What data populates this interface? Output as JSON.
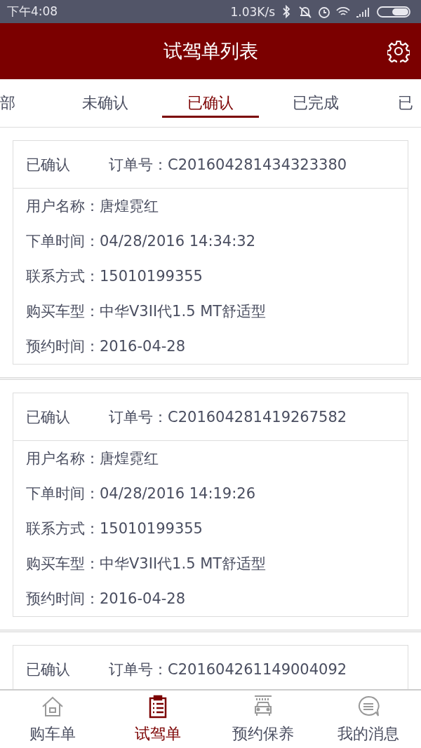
{
  "status_bar": {
    "time": "下午4:08",
    "speed": "1.03K/s"
  },
  "header": {
    "title": "试驾单列表"
  },
  "tabs": [
    {
      "label": "部",
      "selected": false
    },
    {
      "label": "未确认",
      "selected": false
    },
    {
      "label": "已确认",
      "selected": true
    },
    {
      "label": "已完成",
      "selected": false
    },
    {
      "label": "已",
      "selected": false
    }
  ],
  "orders": [
    {
      "status": "已确认",
      "order_label": "订单号：",
      "order_no": "C201604281434323380",
      "fields": [
        {
          "label": "用户名称：",
          "value": "唐煌霓红"
        },
        {
          "label": "下单时间：",
          "value": "04/28/2016 14:34:32"
        },
        {
          "label": "联系方式：",
          "value": "15010199355"
        },
        {
          "label": "购买车型：",
          "value": "中华V3II代1.5 MT舒适型"
        },
        {
          "label": "预约时间：",
          "value": "2016-04-28"
        }
      ]
    },
    {
      "status": "已确认",
      "order_label": "订单号：",
      "order_no": "C201604281419267582",
      "fields": [
        {
          "label": "用户名称：",
          "value": "唐煌霓红"
        },
        {
          "label": "下单时间：",
          "value": "04/28/2016 14:19:26"
        },
        {
          "label": "联系方式：",
          "value": "15010199355"
        },
        {
          "label": "购买车型：",
          "value": "中华V3II代1.5 MT舒适型"
        },
        {
          "label": "预约时间：",
          "value": "2016-04-28"
        }
      ]
    },
    {
      "status": "已确认",
      "order_label": "订单号：",
      "order_no": "C201604261149004092"
    }
  ],
  "bottom_nav": [
    {
      "kind": "home",
      "label": "购车单",
      "selected": false
    },
    {
      "kind": "clipboard",
      "label": "试驾单",
      "selected": true
    },
    {
      "kind": "carwash",
      "label": "预约保养",
      "selected": false
    },
    {
      "kind": "chat",
      "label": "我的消息",
      "selected": false
    }
  ]
}
